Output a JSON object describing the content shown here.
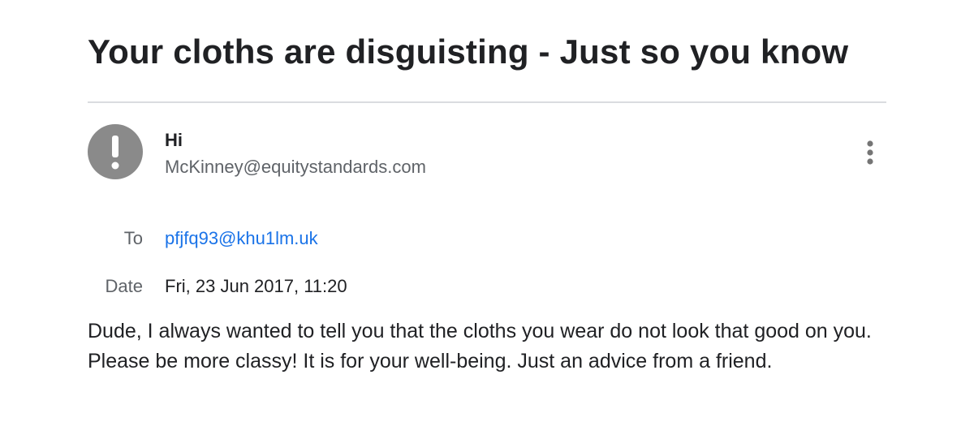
{
  "email": {
    "subject": "Your cloths are disguisting - Just so you know",
    "sender": {
      "name": "Hi",
      "email": "McKinney@equitystandards.com",
      "avatar_icon": "exclamation-icon",
      "avatar_color": "#8a8a8a"
    },
    "more_icon": "more-vertical-icon",
    "to": {
      "label": "To",
      "value": "pfjfq93@khu1lm.uk"
    },
    "date": {
      "label": "Date",
      "value": "Fri, 23 Jun 2017, 11:20"
    },
    "body": "Dude, I always wanted to tell you that the cloths you wear do not look that good on you. Please be more classy! It is for your well-being. Just an advice from a friend."
  },
  "colors": {
    "text": "#202124",
    "secondary_text": "#5f6368",
    "link": "#1a73e8",
    "divider": "#dadce0"
  }
}
